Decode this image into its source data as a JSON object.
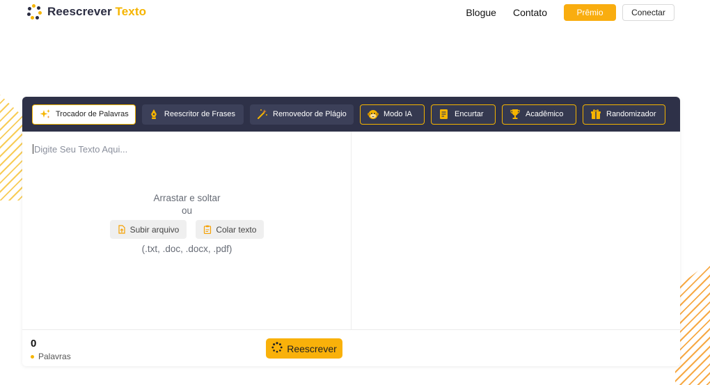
{
  "header": {
    "logo": {
      "primary": "Reescrever",
      "accent": "Texto"
    },
    "nav": {
      "blog": "Blogue",
      "contact": "Contato",
      "premium": "Prêmio",
      "login": "Conectar"
    }
  },
  "toolbar": {
    "tools": [
      {
        "label": "Trocador de Palavras",
        "icon": "sparkle-icon",
        "state": "active"
      },
      {
        "label": "Reescritor de Frases",
        "icon": "pen-nib-icon"
      },
      {
        "label": "Removedor de Plágio",
        "icon": "magic-wand-icon"
      },
      {
        "label": "Modo IA",
        "icon": "monkey-face-icon",
        "premium": true
      },
      {
        "label": "Encurtar",
        "icon": "document-icon",
        "premium": true
      },
      {
        "label": "Acadêmico",
        "icon": "trophy-icon",
        "premium": true
      },
      {
        "label": "Randomizador",
        "icon": "gift-icon",
        "premium": true
      }
    ]
  },
  "editor": {
    "placeholder": "Digite Seu Texto Aqui...",
    "drop_text": "Arrastar e soltar",
    "or_text": "ou",
    "upload_label": "Subir arquivo",
    "paste_label": "Colar texto",
    "formats": "(.txt, .doc, .docx, .pdf)"
  },
  "footer": {
    "word_count": "0",
    "word_label": "Palavras",
    "rewrite_label": "Reescrever"
  },
  "colors": {
    "accent": "#f5b400",
    "toolbar_bg": "#2e3148",
    "premium_button": "#f9ad0f"
  }
}
